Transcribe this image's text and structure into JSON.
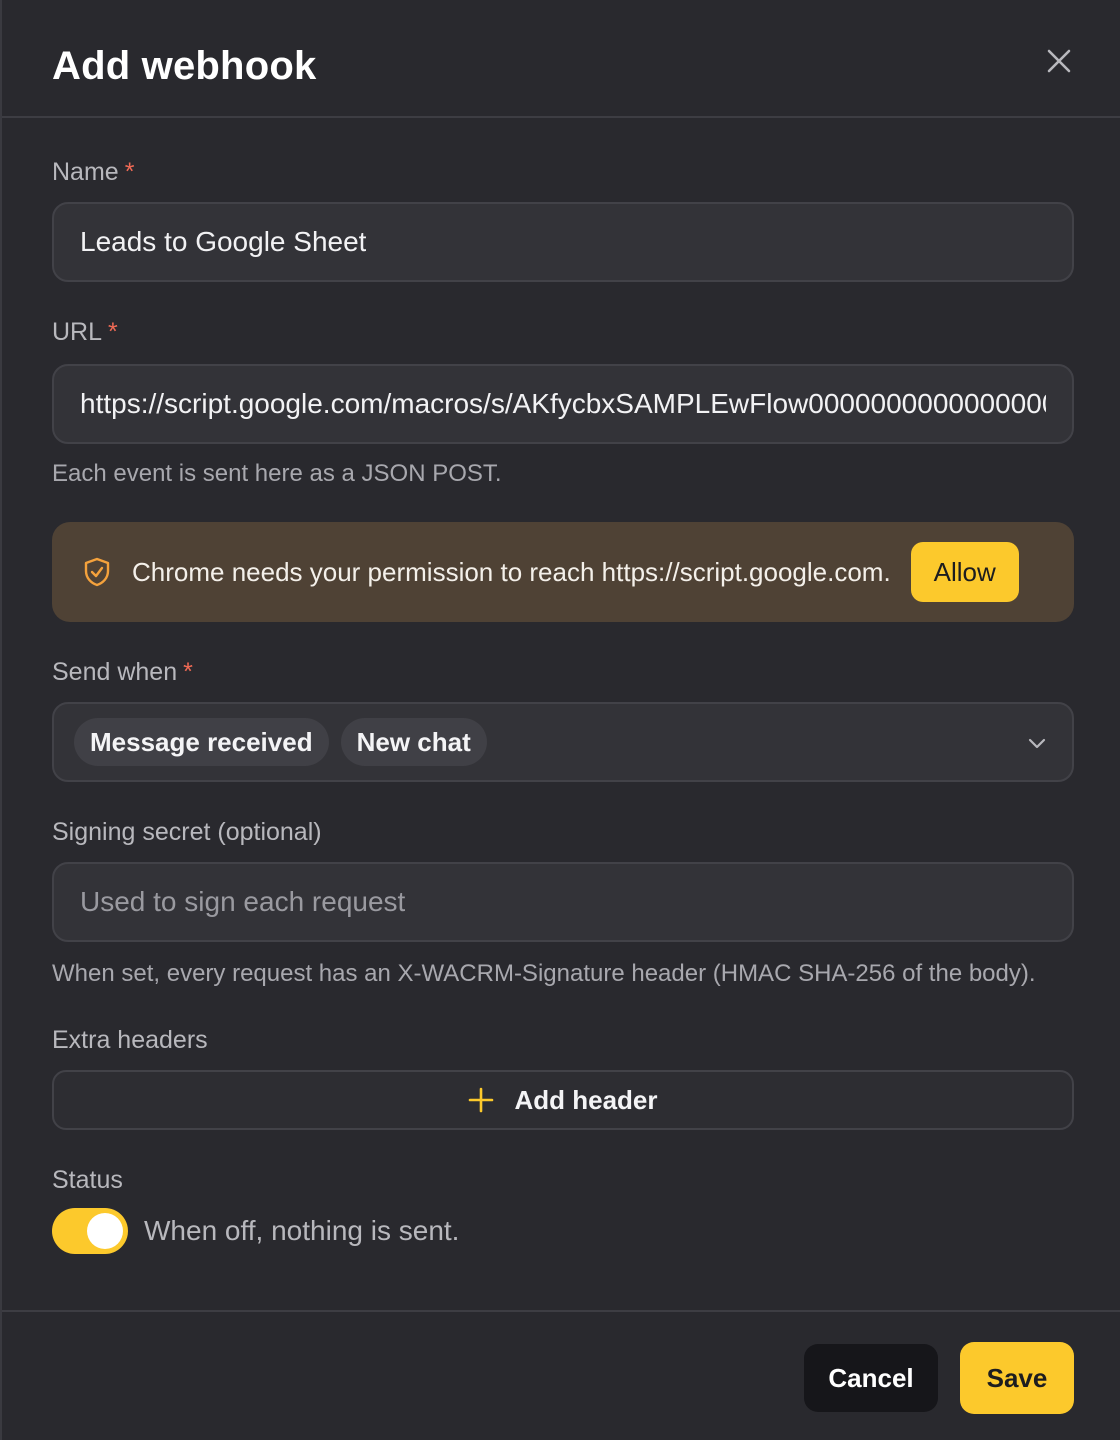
{
  "dialog": {
    "title": "Add webhook",
    "close_icon": "close-icon"
  },
  "name_field": {
    "label": "Name",
    "required_mark": "*",
    "value": "Leads to Google Sheet"
  },
  "url_field": {
    "label": "URL",
    "required_mark": "*",
    "value": "https://script.google.com/macros/s/AKfycbxSAMPLEwFlow0000000000000000",
    "help": "Each event is sent here as a JSON POST."
  },
  "permission_banner": {
    "icon": "shield-check-icon",
    "text": "Chrome needs your permission to reach https://script.google.com.",
    "allow_label": "Allow",
    "background": "#4f4235"
  },
  "send_when": {
    "label": "Send when",
    "required_mark": "*",
    "chips": [
      "Message received",
      "New chat"
    ],
    "dropdown_icon": "chevron-down-icon"
  },
  "signing_secret": {
    "label": "Signing secret (optional)",
    "placeholder": "Used to sign each request",
    "help": "When set, every request has an X-WACRM-Signature header (HMAC SHA-256 of the body)."
  },
  "extra_headers": {
    "label": "Extra headers",
    "add_label": "Add header",
    "add_icon": "plus-icon"
  },
  "status": {
    "label": "Status",
    "enabled": true,
    "help": "When off, nothing is sent."
  },
  "footer": {
    "cancel_label": "Cancel",
    "save_label": "Save"
  },
  "colors": {
    "accent": "#fcc92c",
    "required": "#f06a55",
    "background": "#29292e"
  }
}
